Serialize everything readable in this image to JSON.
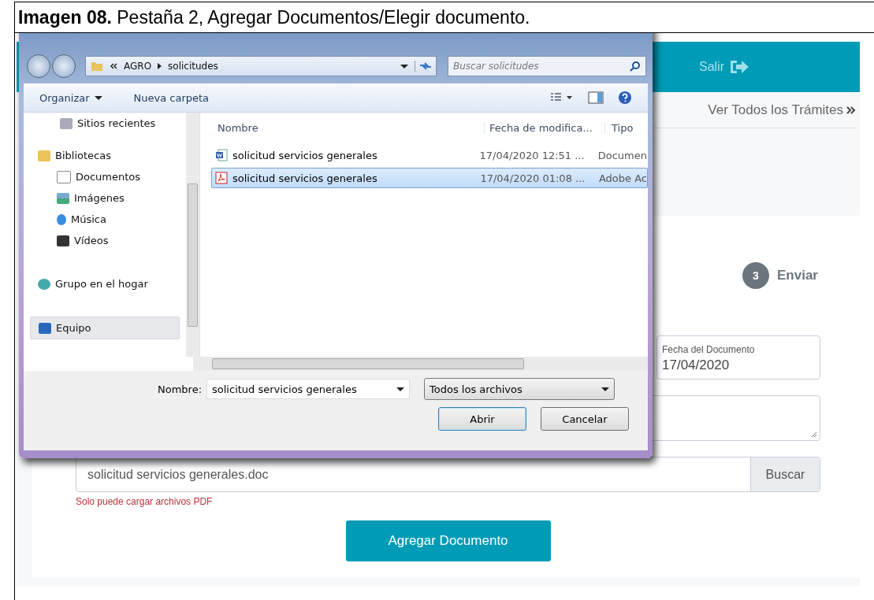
{
  "caption": "**Imagen 08.** Pestaña 2, Agregar Documentos/Elegir documento.",
  "web": {
    "logout": "Salir",
    "all_link": "Ver Todos los Trámites",
    "step": {
      "number": "3",
      "label": "Enviar"
    },
    "date_field": {
      "label": "Fecha del Documento",
      "value": "17/04/2020"
    },
    "file_field": {
      "value": "solicitud servicios generales.doc",
      "button": "Buscar"
    },
    "error": "Solo puede cargar archivos PDF",
    "submit": "Agregar Documento"
  },
  "dialog": {
    "path": [
      "AGRO",
      "solicitudes"
    ],
    "search": {
      "placeholder": "Buscar solicitudes"
    },
    "toolbar": [
      "Organizar",
      "Nueva carpeta"
    ],
    "nav": [
      {
        "kind": "recent",
        "label": "Sitios recientes",
        "selected": false
      },
      {
        "kind": "library",
        "label": "Bibliotecas",
        "selected": false,
        "children": [
          {
            "kind": "documents",
            "label": "Documentos",
            "selected": false
          },
          {
            "kind": "images",
            "label": "Imágenes",
            "selected": false
          },
          {
            "kind": "music",
            "label": "Música",
            "selected": false
          },
          {
            "kind": "videos",
            "label": "Vídeos",
            "selected": false
          }
        ]
      },
      {
        "kind": "homegroup",
        "label": "Grupo en el hogar",
        "selected": false
      },
      {
        "kind": "computer",
        "label": "Equipo",
        "selected": true
      }
    ],
    "columns": [
      "Nombre",
      "Fecha de modifica...",
      "Tipo"
    ],
    "files": [
      {
        "kind": "word",
        "name": "solicitud servicios generales",
        "date": "17/04/2020 12:51 ...",
        "type": "Documen",
        "selected": false
      },
      {
        "kind": "pdf",
        "name": "solicitud servicios generales",
        "date": "17/04/2020 01:08 ...",
        "type": "Adobe Ac",
        "selected": true
      }
    ],
    "name_label": "Nombre:",
    "name_value": "solicitud servicios generales",
    "filter": "Todos los archivos",
    "buttons": [
      "Abrir",
      "Cancelar"
    ]
  }
}
